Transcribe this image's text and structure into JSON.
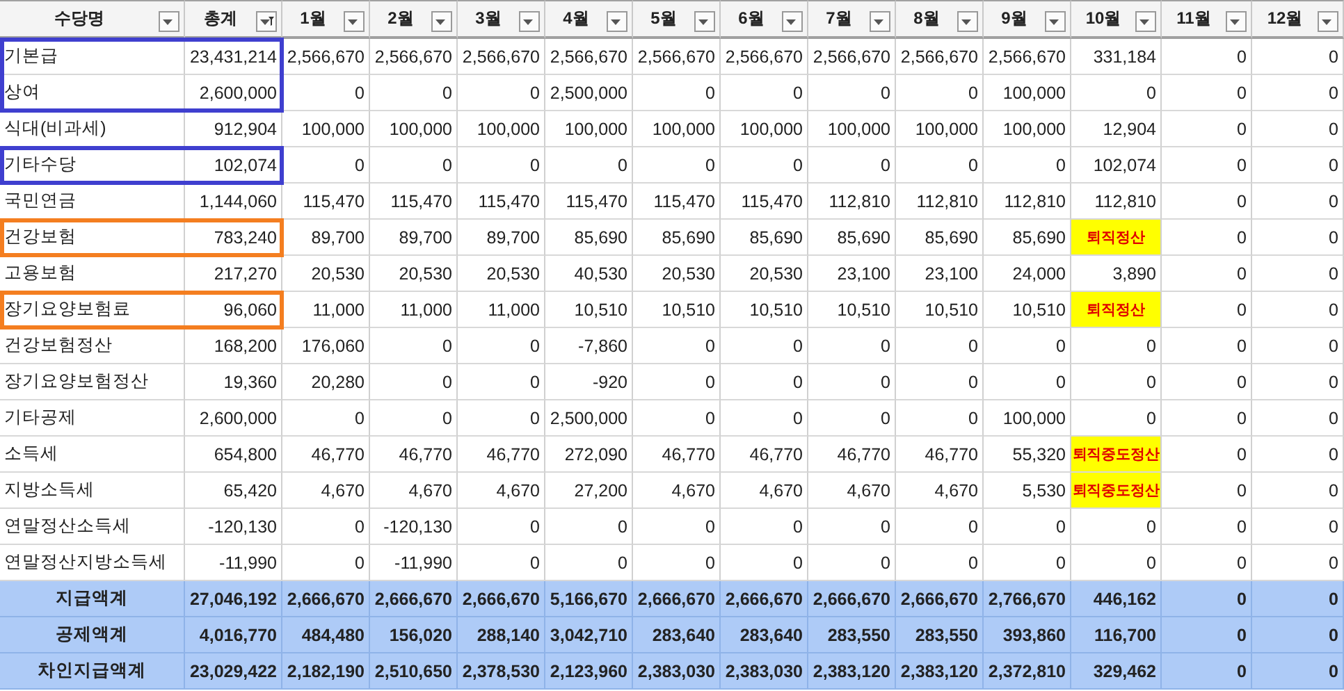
{
  "columns": [
    {
      "label": "수당명",
      "filtered": false
    },
    {
      "label": "총계",
      "filtered": true
    },
    {
      "label": "1월",
      "filtered": false
    },
    {
      "label": "2월",
      "filtered": false
    },
    {
      "label": "3월",
      "filtered": false
    },
    {
      "label": "4월",
      "filtered": false
    },
    {
      "label": "5월",
      "filtered": false
    },
    {
      "label": "6월",
      "filtered": false
    },
    {
      "label": "7월",
      "filtered": false
    },
    {
      "label": "8월",
      "filtered": false
    },
    {
      "label": "9월",
      "filtered": false
    },
    {
      "label": "10월",
      "filtered": false
    },
    {
      "label": "11월",
      "filtered": false
    },
    {
      "label": "12월",
      "filtered": false
    }
  ],
  "rows": [
    {
      "kind": "item",
      "color": "#3f3fcf",
      "name": "기본급",
      "total": "23,431,214",
      "months": [
        "2,566,670",
        "2,566,670",
        "2,566,670",
        "2,566,670",
        "2,566,670",
        "2,566,670",
        "2,566,670",
        "2,566,670",
        "2,566,670",
        "331,184",
        "0",
        "0"
      ]
    },
    {
      "kind": "item",
      "color": "#3f3fcf",
      "name": "상여",
      "total": "2,600,000",
      "months": [
        "0",
        "0",
        "0",
        "2,500,000",
        "0",
        "0",
        "0",
        "0",
        "100,000",
        "0",
        "0",
        "0"
      ]
    },
    {
      "kind": "item",
      "name": "식대(비과세)",
      "total": "912,904",
      "months": [
        "100,000",
        "100,000",
        "100,000",
        "100,000",
        "100,000",
        "100,000",
        "100,000",
        "100,000",
        "100,000",
        "12,904",
        "0",
        "0"
      ]
    },
    {
      "kind": "item",
      "color": "#3f3fcf",
      "name": "기타수당",
      "total": "102,074",
      "months": [
        "0",
        "0",
        "0",
        "0",
        "0",
        "0",
        "0",
        "0",
        "0",
        "102,074",
        "0",
        "0"
      ]
    },
    {
      "kind": "item",
      "name": "국민연금",
      "total": "1,144,060",
      "months": [
        "115,470",
        "115,470",
        "115,470",
        "115,470",
        "115,470",
        "115,470",
        "112,810",
        "112,810",
        "112,810",
        "112,810",
        "0",
        "0"
      ]
    },
    {
      "kind": "item",
      "color": "#f47e20",
      "name": "건강보험",
      "total": "783,240",
      "months": [
        "89,700",
        "89,700",
        "89,700",
        "85,690",
        "85,690",
        "85,690",
        "85,690",
        "85,690",
        "85,690",
        {
          "kind": "note",
          "text": "퇴직정산"
        },
        "0",
        "0"
      ]
    },
    {
      "kind": "item",
      "name": "고용보험",
      "total": "217,270",
      "months": [
        "20,530",
        "20,530",
        "20,530",
        "40,530",
        "20,530",
        "20,530",
        "23,100",
        "23,100",
        "24,000",
        "3,890",
        "0",
        "0"
      ]
    },
    {
      "kind": "item",
      "color": "#f47e20",
      "name": "장기요양보험료",
      "total": "96,060",
      "months": [
        "11,000",
        "11,000",
        "11,000",
        "10,510",
        "10,510",
        "10,510",
        "10,510",
        "10,510",
        "10,510",
        {
          "kind": "note",
          "text": "퇴직정산"
        },
        "0",
        "0"
      ]
    },
    {
      "kind": "item",
      "name": "건강보험정산",
      "total": "168,200",
      "months": [
        "176,060",
        "0",
        "0",
        "-7,860",
        "0",
        "0",
        "0",
        "0",
        "0",
        "0",
        "0",
        "0"
      ]
    },
    {
      "kind": "item",
      "name": "장기요양보험정산",
      "total": "19,360",
      "months": [
        "20,280",
        "0",
        "0",
        "-920",
        "0",
        "0",
        "0",
        "0",
        "0",
        "0",
        "0",
        "0"
      ]
    },
    {
      "kind": "item",
      "name": "기타공제",
      "total": "2,600,000",
      "months": [
        "0",
        "0",
        "0",
        "2,500,000",
        "0",
        "0",
        "0",
        "0",
        "100,000",
        "0",
        "0",
        "0"
      ]
    },
    {
      "kind": "item",
      "name": "소득세",
      "total": "654,800",
      "months": [
        "46,770",
        "46,770",
        "46,770",
        "272,090",
        "46,770",
        "46,770",
        "46,770",
        "46,770",
        "55,320",
        {
          "kind": "note",
          "text": "퇴직중도정산"
        },
        "0",
        "0"
      ]
    },
    {
      "kind": "item",
      "name": "지방소득세",
      "total": "65,420",
      "months": [
        "4,670",
        "4,670",
        "4,670",
        "27,200",
        "4,670",
        "4,670",
        "4,670",
        "4,670",
        "5,530",
        {
          "kind": "note",
          "text": "퇴직중도정산"
        },
        "0",
        "0"
      ]
    },
    {
      "kind": "item",
      "name": "연말정산소득세",
      "total": "-120,130",
      "months": [
        "0",
        "-120,130",
        "0",
        "0",
        "0",
        "0",
        "0",
        "0",
        "0",
        "0",
        "0",
        "0"
      ]
    },
    {
      "kind": "item",
      "name": "연말정산지방소득세",
      "total": "-11,990",
      "months": [
        "0",
        "-11,990",
        "0",
        "0",
        "0",
        "0",
        "0",
        "0",
        "0",
        "0",
        "0",
        "0"
      ]
    },
    {
      "kind": "sum",
      "name": "지급액계",
      "total": "27,046,192",
      "months": [
        "2,666,670",
        "2,666,670",
        "2,666,670",
        "5,166,670",
        "2,666,670",
        "2,666,670",
        "2,666,670",
        "2,666,670",
        "2,766,670",
        "446,162",
        "0",
        "0"
      ]
    },
    {
      "kind": "sum",
      "name": "공제액계",
      "total": "4,016,770",
      "months": [
        "484,480",
        "156,020",
        "288,140",
        "3,042,710",
        "283,640",
        "283,640",
        "283,550",
        "283,550",
        "393,860",
        "116,700",
        "0",
        "0"
      ]
    },
    {
      "kind": "sum",
      "name": "차인지급액계",
      "total": "23,029,422",
      "months": [
        "2,182,190",
        "2,510,650",
        "2,378,530",
        "2,123,960",
        "2,383,030",
        "2,383,030",
        "2,383,120",
        "2,383,120",
        "2,372,810",
        "329,462",
        "0",
        "0"
      ]
    }
  ]
}
